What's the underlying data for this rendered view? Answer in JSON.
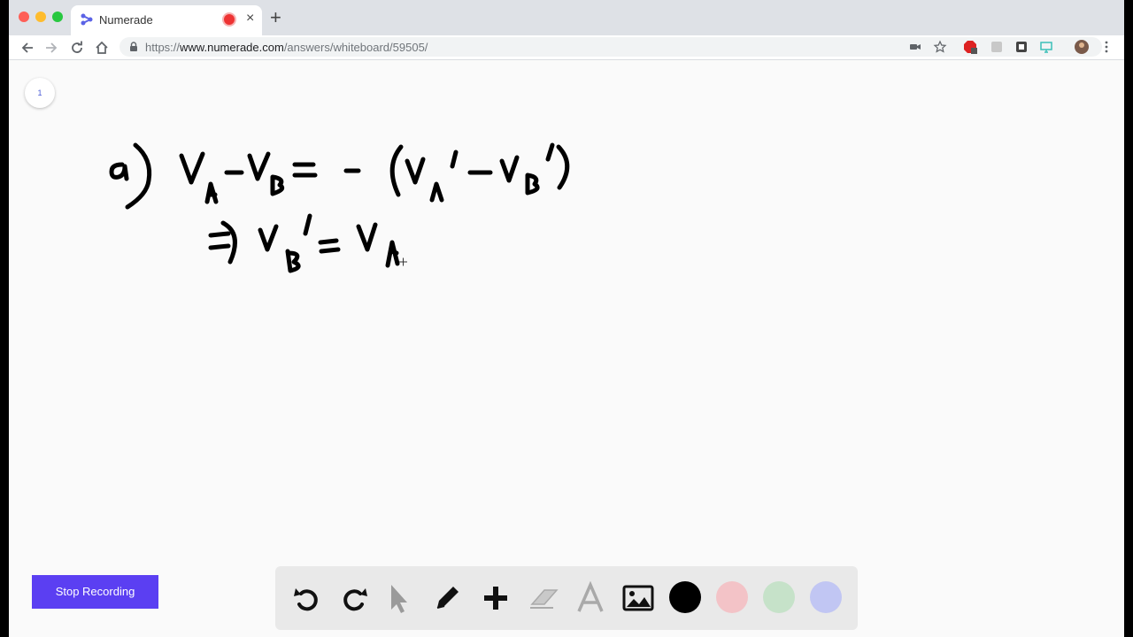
{
  "browser": {
    "tab_title": "Numerade",
    "url_scheme": "https://",
    "url_host": "www.numerade.com",
    "url_path": "/answers/whiteboard/59505/",
    "extensions": [
      "video-camera-icon",
      "star-icon",
      "abp-extension-icon",
      "extension-icon",
      "code-extension-icon",
      "screen-extension-icon",
      "profile-avatar-icon",
      "kebab-menu-icon"
    ]
  },
  "page": {
    "page_number": "1",
    "stop_recording_label": "Stop Recording"
  },
  "whiteboard": {
    "handwriting_lines": [
      "a) vA - vB = - (vA' - vB')",
      "=> vB' = vA"
    ]
  },
  "toolbar": {
    "tools": [
      "undo-icon",
      "redo-icon",
      "select-cursor-icon",
      "pencil-icon",
      "add-shape-icon",
      "eraser-icon",
      "text-icon",
      "image-icon"
    ],
    "colors": [
      "#000000",
      "#f3c3c7",
      "#c6e2c9",
      "#c1c6f3"
    ]
  }
}
